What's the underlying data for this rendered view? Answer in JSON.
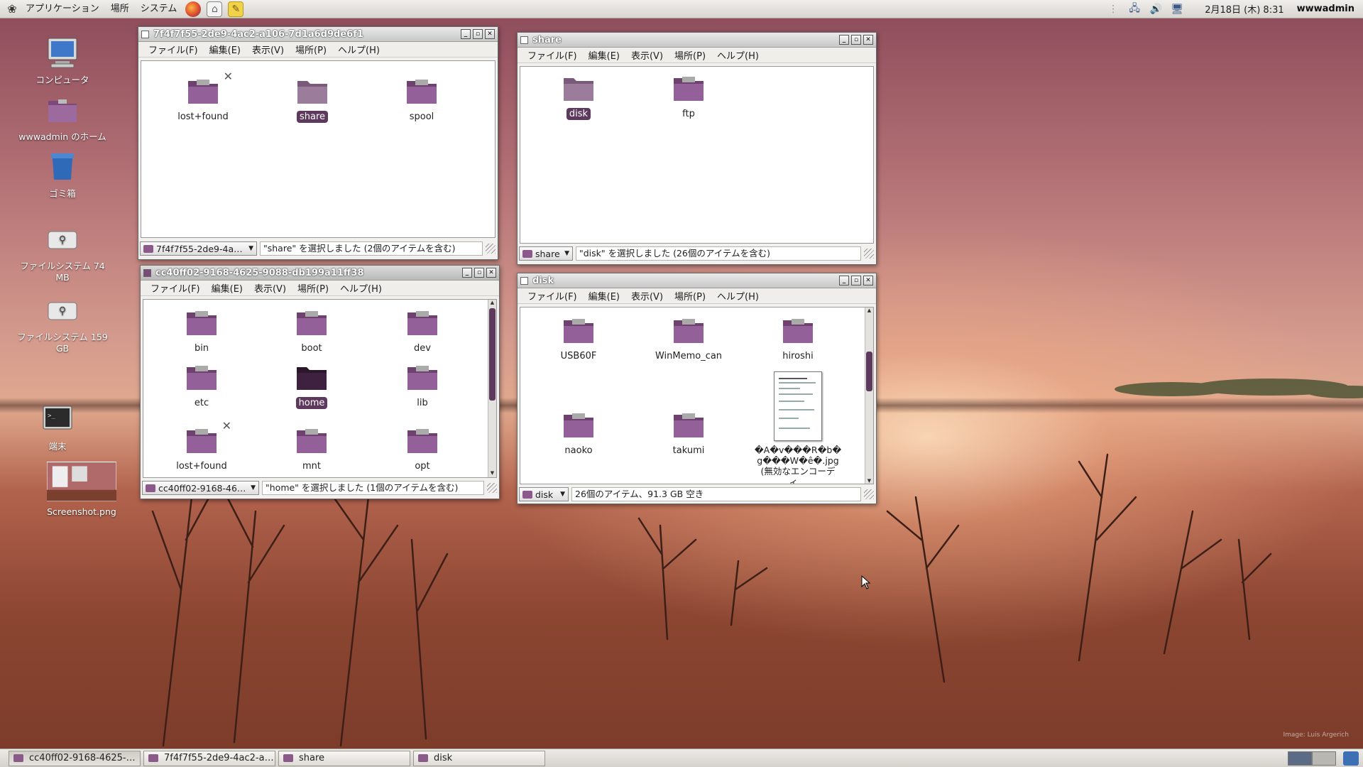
{
  "top_panel": {
    "menus": [
      "アプリケーション",
      "場所",
      "システム"
    ],
    "launchers": [
      "firefox-icon",
      "home-launcher-icon",
      "notes-icon"
    ],
    "clock": "2月18日 (木) 8:31",
    "user": "wwwadmin"
  },
  "desktop_icons": [
    {
      "label": "コンピュータ",
      "icon": "computer-icon"
    },
    {
      "label": "wwwadmin のホーム",
      "icon": "home-folder-icon"
    },
    {
      "label": "ゴミ箱",
      "icon": "trash-icon"
    },
    {
      "label": "ファイルシステム 74 MB",
      "icon": "usb-drive-icon"
    },
    {
      "label": "ファイルシステム 159 GB",
      "icon": "usb-drive-icon"
    },
    {
      "label": "端末",
      "icon": "terminal-icon"
    },
    {
      "label": "Screenshot.png",
      "icon": "image-file-icon"
    }
  ],
  "file_menu": [
    "ファイル(F)",
    "編集(E)",
    "表示(V)",
    "場所(P)",
    "ヘルプ(H)"
  ],
  "windows": {
    "w1": {
      "title": "7f4f7f55-2de9-4ac2-a106-7d1a6d9de6f1",
      "location": "7f4f7f55-2de9-4a…",
      "status": "\"share\" を選択しました (2個のアイテムを含む)",
      "items": [
        {
          "label": "lost+found",
          "selected": false,
          "broken": true
        },
        {
          "label": "share",
          "selected": true,
          "broken": false
        },
        {
          "label": "spool",
          "selected": false,
          "broken": false
        }
      ]
    },
    "w2": {
      "title": "share",
      "location": "share",
      "status": "\"disk\" を選択しました (26個のアイテムを含む)",
      "items": [
        {
          "label": "disk",
          "selected": true
        },
        {
          "label": "ftp",
          "selected": false
        }
      ]
    },
    "w3": {
      "title": "cc40ff02-9168-4625-9088-db199a11ff38",
      "location": "cc40ff02-9168-46…",
      "status": "\"home\" を選択しました (1個のアイテムを含む)",
      "items": [
        {
          "label": "bin"
        },
        {
          "label": "boot"
        },
        {
          "label": "dev"
        },
        {
          "label": "etc"
        },
        {
          "label": "home",
          "selected": true
        },
        {
          "label": "lib"
        },
        {
          "label": "lost+found",
          "broken": true
        },
        {
          "label": "mnt"
        },
        {
          "label": "opt"
        }
      ]
    },
    "w4": {
      "title": "disk",
      "location": "disk",
      "status": "26個のアイテム、91.3 GB 空き",
      "items": [
        {
          "label": "USB60F"
        },
        {
          "label": "WinMemo_can"
        },
        {
          "label": "hiroshi"
        },
        {
          "label": "naoko"
        },
        {
          "label": "takumi"
        },
        {
          "label": "�A�v���R�b�g���W�ê�.jpg (無効なエンコーディ…",
          "type": "image"
        }
      ]
    }
  },
  "taskbar": [
    {
      "label": "cc40ff02-9168-4625-…",
      "active": true
    },
    {
      "label": "7f4f7f55-2de9-4ac2-a…",
      "active": false
    },
    {
      "label": "share",
      "active": false
    },
    {
      "label": "disk",
      "active": false
    }
  ],
  "credit": "Image: Luis Argerich",
  "colors": {
    "accent": "#5d3a5d",
    "folder": "#8b5a8b"
  }
}
